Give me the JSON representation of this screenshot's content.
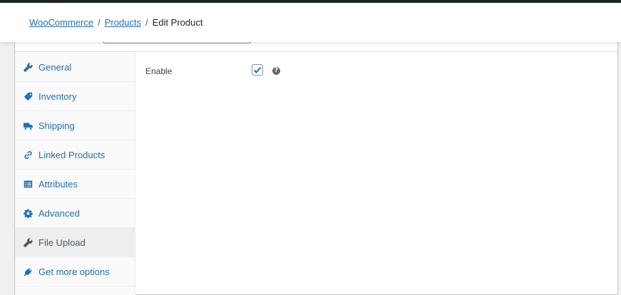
{
  "breadcrumb": {
    "items": [
      "WooCommerce",
      "Products"
    ],
    "separator": "/",
    "current": "Edit Product"
  },
  "product_data": {
    "tabs": [
      {
        "label": "General",
        "icon": "wrench-icon",
        "active": false
      },
      {
        "label": "Inventory",
        "icon": "tag-icon",
        "active": false
      },
      {
        "label": "Shipping",
        "icon": "truck-icon",
        "active": false
      },
      {
        "label": "Linked Products",
        "icon": "link-icon",
        "active": false
      },
      {
        "label": "Attributes",
        "icon": "list-icon",
        "active": false
      },
      {
        "label": "Advanced",
        "icon": "gear-icon",
        "active": false
      },
      {
        "label": "File Upload",
        "icon": "wrench-icon",
        "active": true
      },
      {
        "label": "Get more options",
        "icon": "plugin-icon",
        "active": false
      }
    ],
    "fields": {
      "enable": {
        "label": "Enable",
        "checked": true,
        "help": "?"
      }
    }
  },
  "colors": {
    "link": "#2271b1",
    "active_text": "#50575e",
    "admin_bar": "#1d2327"
  }
}
